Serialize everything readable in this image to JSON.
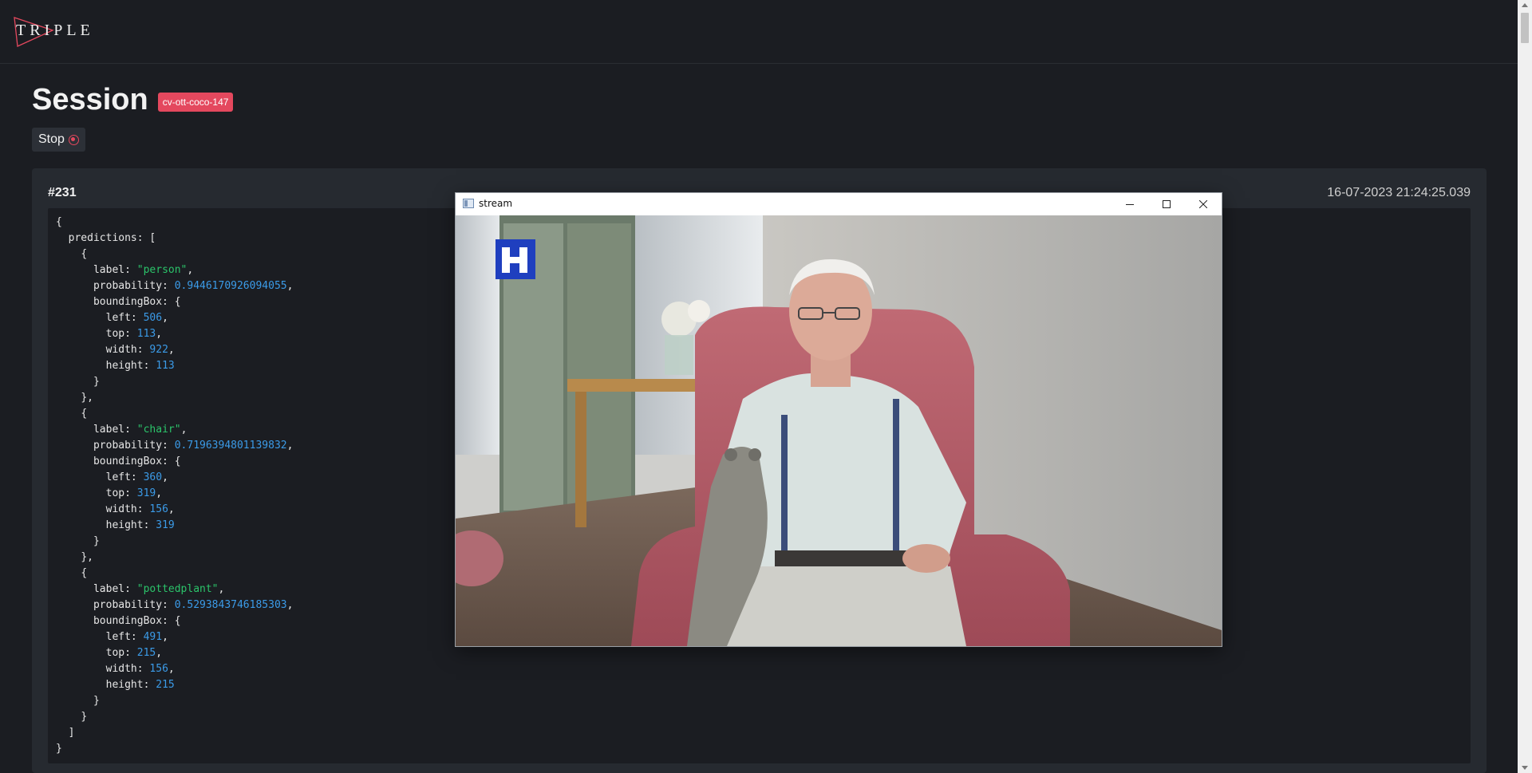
{
  "header": {
    "logo_text": "TRIPLE",
    "accent": "#e4485e"
  },
  "session": {
    "title": "Session",
    "badge": "cv-ott-coco-147",
    "stop_label": "Stop"
  },
  "frame": {
    "id": "#231",
    "timestamp": "16-07-2023 21:24:25.039",
    "predictions": [
      {
        "label": "person",
        "probability": "0.9446170926094055",
        "boundingBox": {
          "left": "506",
          "top": "113",
          "width": "922",
          "height": "113"
        }
      },
      {
        "label": "chair",
        "probability": "0.7196394801139832",
        "boundingBox": {
          "left": "360",
          "top": "319",
          "width": "156",
          "height": "319"
        }
      },
      {
        "label": "pottedplant",
        "probability": "0.5293843746185303",
        "boundingBox": {
          "left": "491",
          "top": "215",
          "width": "156",
          "height": "215"
        }
      }
    ]
  },
  "stream_window": {
    "title": "stream",
    "minimize_icon": "minimize-icon",
    "maximize_icon": "maximize-icon",
    "close_icon": "close-icon"
  },
  "colors": {
    "string": "#2bc46a",
    "number": "#3b9be8",
    "badge": "#e4485e"
  }
}
